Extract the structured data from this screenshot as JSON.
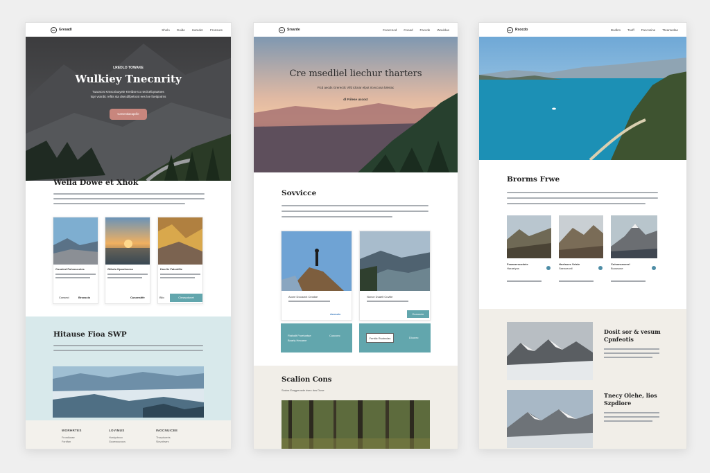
{
  "colors": {
    "teal": "#62a6ad",
    "rose": "#c8867d",
    "light_teal": "#cfe3e5",
    "light_beige": "#f1eee8"
  },
  "pages": {
    "p1": {
      "brand": "Gresadl",
      "nav": [
        "Sholo",
        "Guide",
        "Hareder",
        "Fronsure"
      ],
      "hero": {
        "eyebrow": "LREDLO TOWAKE",
        "title": "Wulkiey Tnecnrity",
        "line1": "Tuacscrs Krsscniaoyeie Kreidse tco teclceliqraotnes",
        "line2": "tspr vssrdic reftts sta dsecdlfpelocsi ees loe foetipotrns",
        "button": "Carsentiaeapclle"
      },
      "section1_title": "Wella Dowe et Xhok",
      "cards": [
        {
          "title": "Counted Fuhscucctes",
          "action": "Brsoscio",
          "prefix": "Conseci"
        },
        {
          "title": "Giforlo Hpoolnsess",
          "action": "Cusonsitfe",
          "prefix": ""
        },
        {
          "title": "Hoo lie Fatcnifiie",
          "action": "Cinsepdunet",
          "prefix": "Bllo"
        }
      ],
      "section2_title": "Hitause Fioa SWP",
      "footer": [
        {
          "title": "WORHRTES",
          "items": [
            "Frondlusse",
            "Fordfan"
          ]
        },
        {
          "title": "LOVIMUS",
          "items": [
            "Hurdyctwco",
            "Guoewuuxocs"
          ]
        },
        {
          "title": "INOCNUICEE",
          "items": [
            "Thorpisceris",
            "Slovufowrs"
          ]
        }
      ]
    },
    "p2": {
      "brand": "Srsarde",
      "nav": [
        "Conecnod",
        "Cooad",
        "Faccde",
        "Wouldue"
      ],
      "hero": {
        "title": "Cre msedliel liechur tharters",
        "line1": "Ficd aecds Grerectlc Vifd idcnar elpot riceccosa loleriac",
        "line2": "dl Frilese uccoct"
      },
      "section1_title": "Sovvicce",
      "cards": [
        {
          "title": "Aocnr Dccaurct Ceodse",
          "action": "Acoscic"
        },
        {
          "title": "Nonce Duaelt Cuvilie",
          "action": "Dunoscie"
        }
      ],
      "teal_cards": [
        {
          "text": "Fiafodlt Froetuntae",
          "text2": "Boarly Hecasre",
          "link": "Cuscoec"
        },
        {
          "button": "Fenttic Rsotnclas",
          "link": "Dicorec"
        }
      ],
      "section2_title": "Scalion Cons",
      "section2_sub": "Sodos Eragpeosde dsec dus Duse"
    },
    "p3": {
      "brand": "Rsocdo",
      "nav": [
        "Bodkm",
        "Tooff",
        "Faccosine",
        "Ttearsedae"
      ],
      "section1_title": "Brorms Frwe",
      "thumbs": [
        {
          "caption": "Fouaserscodcte",
          "caption2": "Haraeiyus"
        },
        {
          "caption": "Hoelsues Velsle",
          "caption2": "Ssenceonil"
        },
        {
          "caption": "Cuisonseoeerl",
          "caption2": "Buossose"
        }
      ],
      "feature1": {
        "title": "Dosit sor & vesum",
        "title2": "Cpnfeotis"
      },
      "feature2": {
        "title": "Tnecy Olehe, lios",
        "title2": "Szpdiore"
      }
    }
  }
}
